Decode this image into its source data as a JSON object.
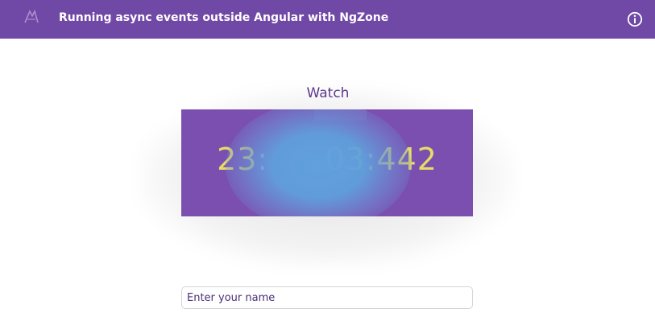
{
  "header": {
    "title": "Running async events outside Angular with NgZone",
    "logo_icon": "angular-logo-icon",
    "info_icon": "info-icon",
    "background_color": "#7048a6"
  },
  "watch": {
    "heading": "Watch",
    "time_hours": "23",
    "time_minutes_visible": "",
    "time_seconds_visible": "03",
    "time_millis": "442",
    "separator": ":",
    "face_color": "#7a4fb0",
    "digit_color": "#e4dd66"
  },
  "name_input": {
    "placeholder": "Enter your name",
    "value": ""
  }
}
